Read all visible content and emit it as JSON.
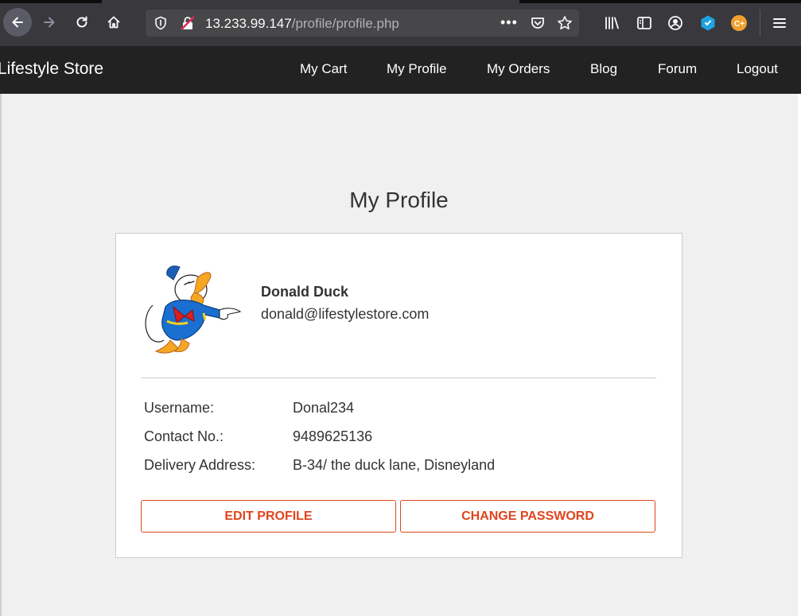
{
  "browser": {
    "url_host": "13.233.99.147",
    "url_path": "/profile/profile.php",
    "more_label": "•••",
    "icons": [
      "back-arrow-icon",
      "forward-arrow-icon",
      "reload-icon",
      "home-icon",
      "shield-icon",
      "insecure-lock-icon",
      "pocket-icon",
      "star-icon",
      "library-icon",
      "sidebar-icon",
      "account-icon",
      "extension-icon",
      "extension-c-icon",
      "hamburger-menu-icon"
    ]
  },
  "site": {
    "brand": "Lifestyle Store",
    "nav": {
      "cart": "My Cart",
      "profile": "My Profile",
      "orders": "My Orders",
      "blog": "Blog",
      "forum": "Forum",
      "logout": "Logout"
    }
  },
  "profile": {
    "title": "My Profile",
    "name": "Donald Duck",
    "email": "donald@lifestylestore.com",
    "rows": [
      {
        "label": "Username:",
        "value": "Donal234"
      },
      {
        "label": "Contact No.:",
        "value": "9489625136"
      },
      {
        "label": "Delivery Address:",
        "value": "B-34/ the duck lane, Disneyland"
      }
    ],
    "buttons": {
      "edit": "EDIT PROFILE",
      "change_password": "CHANGE PASSWORD"
    }
  },
  "colors": {
    "accent": "#e0441c",
    "navbar": "#222222",
    "browser_toolbar": "#38383d",
    "page_bg": "#f0f0f0"
  }
}
